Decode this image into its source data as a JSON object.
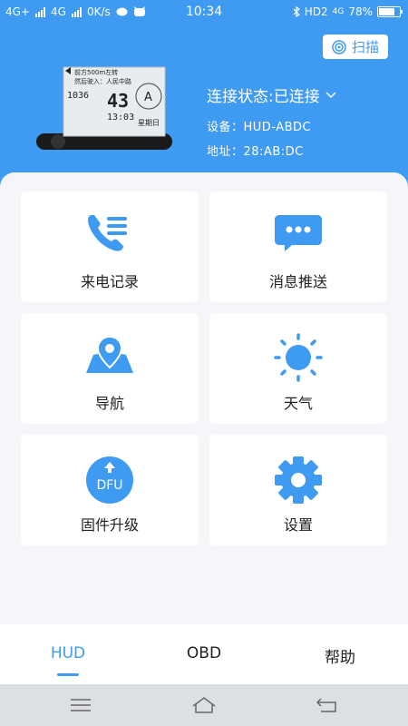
{
  "status_bar": {
    "net1": "4G+",
    "net2": "4G",
    "speed": "0K/s",
    "time": "10:34",
    "hd": "HD2",
    "net3": "4G",
    "battery": "78%",
    "battery_level": 0.78
  },
  "header": {
    "scan_label": "扫描",
    "connection_state": "连接状态:已连接",
    "device_label": "设备：",
    "device_value": "HUD-ABDC",
    "address_label": "地址：",
    "address_value": "28:AB:DC"
  },
  "hud_display": {
    "line1": "前方500m左转",
    "line2": "然后驶入：人民中路",
    "time1": "1036",
    "speed": "43",
    "time2": "13:03",
    "weekday": "星期日",
    "compass": "A"
  },
  "menu": [
    {
      "label": "来电记录",
      "icon": "phone-list-icon"
    },
    {
      "label": "消息推送",
      "icon": "message-icon"
    },
    {
      "label": "导航",
      "icon": "map-pin-icon"
    },
    {
      "label": "天气",
      "icon": "sun-icon"
    },
    {
      "label": "固件升级",
      "icon": "dfu-upgrade-icon",
      "badge": "DFU"
    },
    {
      "label": "设置",
      "icon": "gear-icon"
    }
  ],
  "tabs": [
    {
      "label": "HUD",
      "active": true
    },
    {
      "label": "OBD",
      "active": false
    },
    {
      "label": "帮助",
      "active": false
    }
  ],
  "colors": {
    "accent": "#3f9af1",
    "card_bg": "#ffffff",
    "panel_bg": "#f4f6f9"
  }
}
